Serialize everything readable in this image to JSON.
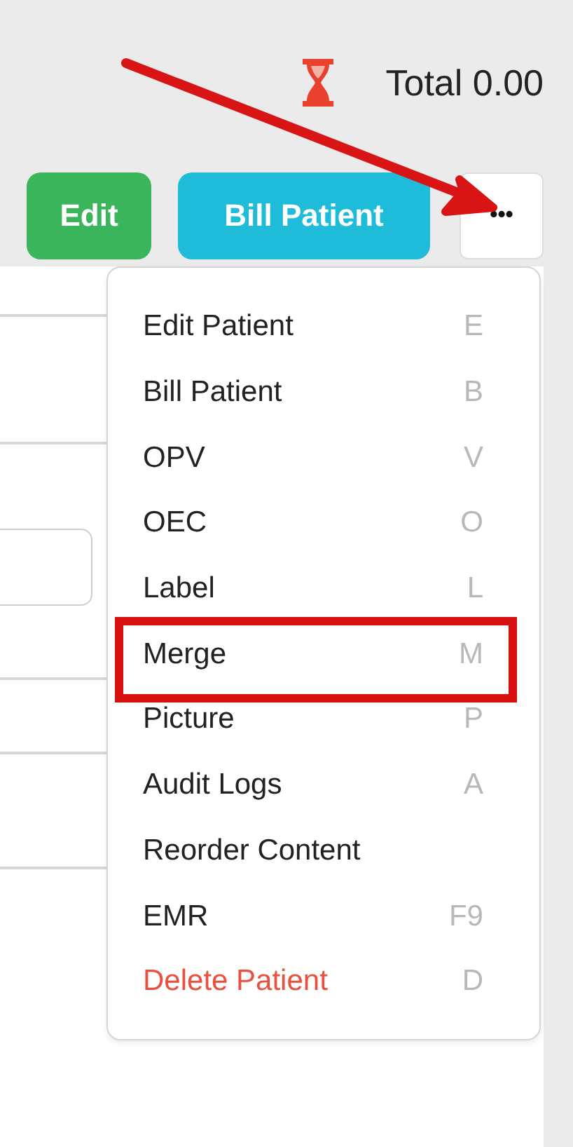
{
  "header": {
    "total": "Total 0.00"
  },
  "buttons": [
    {
      "label": "Edit",
      "kind": "success"
    },
    {
      "label": "Bill Patient",
      "kind": "info"
    },
    {
      "label": "•••",
      "kind": "more"
    }
  ],
  "menu": {
    "items": [
      {
        "label": "Edit Patient",
        "shortcut": "E",
        "danger": false,
        "highlighted": false
      },
      {
        "label": "Bill Patient",
        "shortcut": "B",
        "danger": false,
        "highlighted": false
      },
      {
        "label": "OPV",
        "shortcut": "V",
        "danger": false,
        "highlighted": false
      },
      {
        "label": "OEC",
        "shortcut": "O",
        "danger": false,
        "highlighted": false
      },
      {
        "label": "Label",
        "shortcut": "L",
        "danger": false,
        "highlighted": false
      },
      {
        "label": "Merge",
        "shortcut": "M",
        "danger": false,
        "highlighted": true
      },
      {
        "label": "Picture",
        "shortcut": "P",
        "danger": false,
        "highlighted": false
      },
      {
        "label": "Audit Logs",
        "shortcut": "A",
        "danger": false,
        "highlighted": false
      },
      {
        "label": "Reorder Content",
        "danger": false,
        "highlighted": false
      },
      {
        "label": "EMR",
        "shortcut": "F9",
        "danger": false,
        "highlighted": false
      },
      {
        "label": "Delete Patient",
        "shortcut": "D",
        "danger": true,
        "highlighted": false
      }
    ]
  }
}
